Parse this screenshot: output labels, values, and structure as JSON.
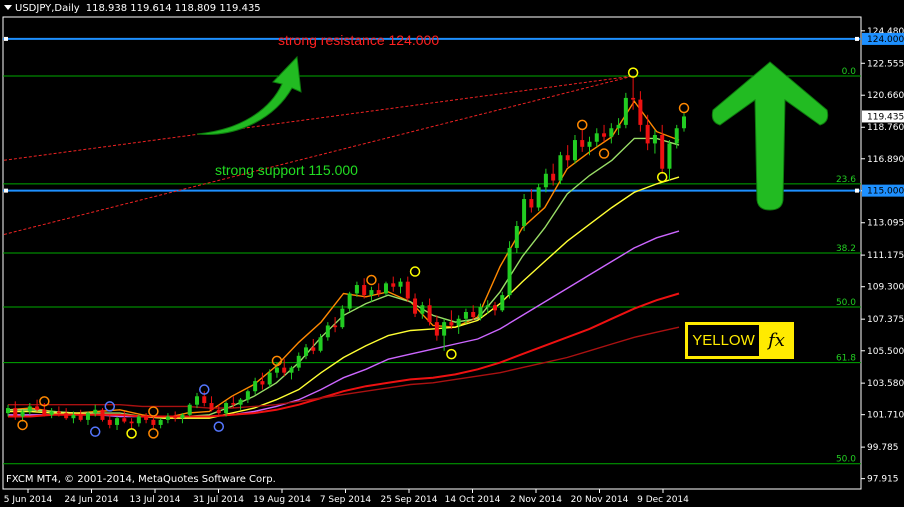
{
  "header": {
    "symbol": "USDJPY,Daily",
    "ohlc": "118.938 119.614 118.809 119.435"
  },
  "footer": {
    "copyright": "FXCM MT4, © 2001-2014, MetaQuotes Software Corp."
  },
  "annotations": {
    "resistance_text": "strong resistance 124.000",
    "support_text": "strong support 115.000",
    "logo_word": "YELLOW",
    "logo_mark": "fx"
  },
  "colors": {
    "background": "#000000",
    "grid_line": "#00aa00",
    "key_line": "#1e90ff",
    "bull": "#22cc22",
    "bear": "#ee1111",
    "ma_fast": "#ff8800",
    "ma_green": "#99dd66",
    "ma_yellow": "#ffff33",
    "ma_purple": "#cc66ff",
    "ma_red": "#ee1111",
    "ma_darkred": "#aa1111",
    "arrow_green": "#22bb22",
    "logo_yellow": "#ffeb00"
  },
  "chart_data": {
    "type": "candlestick",
    "price_axis": {
      "ticks": [
        "124.480",
        "122.555",
        "120.660",
        "118.760",
        "116.890",
        "114.990",
        "113.095",
        "111.175",
        "109.300",
        "107.375",
        "105.500",
        "103.580",
        "101.710",
        "99.785",
        "97.915"
      ],
      "ylim": [
        97.3,
        125.3
      ],
      "current_price_label": "119.435"
    },
    "date_axis": {
      "labels": [
        "5 Jun 2014",
        "24 Jun 2014",
        "13 Jul 2014",
        "31 Jul 2014",
        "19 Aug 2014",
        "7 Sep 2014",
        "25 Sep 2014",
        "14 Oct 2014",
        "2 Nov 2014",
        "20 Nov 2014",
        "9 Dec 2014"
      ]
    },
    "key_levels": [
      {
        "price": 124.0,
        "label": "124.000"
      },
      {
        "price": 115.0,
        "label": "115.000"
      }
    ],
    "fibonacci": [
      {
        "level": "0.0",
        "price": 121.8
      },
      {
        "level": "23.6",
        "price": 115.4
      },
      {
        "level": "38.2",
        "price": 111.3
      },
      {
        "level": "50.0",
        "price": 108.1
      },
      {
        "level": "61.8",
        "price": 104.8
      },
      {
        "level": "50.0",
        "price": 98.8
      }
    ],
    "moving_averages": [
      {
        "color_key": "ma_fast",
        "values": [
          102.0,
          102.1,
          101.9,
          101.8,
          101.9,
          102.0,
          101.7,
          101.5,
          101.8,
          101.9,
          102.8,
          103.5,
          104.6,
          106.0,
          107.2,
          108.9,
          108.7,
          109.0,
          108.4,
          107.0,
          106.9,
          107.5,
          110.5,
          112.8,
          114.0,
          116.3,
          117.3,
          118.2,
          120.3,
          118.5,
          118.0
        ]
      },
      {
        "color_key": "ma_green",
        "values": [
          102.0,
          102.0,
          101.9,
          101.8,
          101.8,
          101.8,
          101.6,
          101.5,
          101.6,
          101.7,
          102.2,
          102.8,
          103.6,
          104.8,
          106.3,
          107.6,
          108.3,
          108.8,
          108.4,
          107.6,
          107.2,
          107.4,
          109.0,
          111.1,
          112.8,
          114.8,
          115.9,
          116.8,
          118.1,
          118.1,
          117.7
        ]
      },
      {
        "color_key": "ma_yellow",
        "values": [
          101.9,
          101.9,
          101.8,
          101.8,
          101.7,
          101.7,
          101.6,
          101.5,
          101.5,
          101.5,
          101.8,
          102.1,
          102.6,
          103.2,
          104.2,
          105.1,
          105.8,
          106.4,
          106.7,
          106.8,
          106.9,
          107.3,
          108.3,
          109.6,
          110.8,
          112.0,
          113.0,
          114.0,
          114.9,
          115.4,
          115.8
        ]
      },
      {
        "color_key": "ma_purple",
        "values": [
          101.7,
          101.7,
          101.7,
          101.7,
          101.7,
          101.6,
          101.6,
          101.6,
          101.6,
          101.6,
          101.7,
          101.9,
          102.2,
          102.6,
          103.2,
          103.9,
          104.4,
          105.0,
          105.3,
          105.6,
          105.9,
          106.2,
          106.8,
          107.6,
          108.4,
          109.2,
          110.0,
          110.8,
          111.6,
          112.2,
          112.6
        ]
      },
      {
        "color_key": "ma_red",
        "values": [
          101.6,
          101.6,
          101.7,
          101.7,
          101.7,
          101.7,
          101.6,
          101.6,
          101.6,
          101.6,
          101.7,
          101.8,
          102.0,
          102.3,
          102.7,
          103.1,
          103.4,
          103.6,
          103.8,
          103.9,
          104.1,
          104.4,
          104.8,
          105.3,
          105.8,
          106.3,
          106.8,
          107.4,
          108.0,
          108.5,
          108.9
        ]
      },
      {
        "color_key": "ma_darkred",
        "values": [
          102.3,
          102.3,
          102.3,
          102.3,
          102.3,
          102.3,
          102.2,
          102.2,
          102.2,
          102.1,
          102.1,
          102.2,
          102.3,
          102.5,
          102.7,
          102.9,
          103.1,
          103.3,
          103.5,
          103.6,
          103.8,
          104.0,
          104.2,
          104.5,
          104.8,
          105.1,
          105.5,
          105.9,
          106.3,
          106.6,
          106.9
        ]
      }
    ],
    "candles": [
      [
        101.8,
        102.3,
        101.6,
        102.1
      ],
      [
        102.1,
        102.5,
        101.4,
        101.6
      ],
      [
        101.6,
        102.0,
        101.3,
        101.9
      ],
      [
        101.9,
        102.4,
        101.7,
        102.2
      ],
      [
        102.2,
        102.6,
        101.9,
        102.0
      ],
      [
        102.0,
        102.4,
        101.6,
        101.7
      ],
      [
        101.7,
        102.1,
        101.5,
        101.9
      ],
      [
        101.9,
        102.2,
        101.6,
        101.8
      ],
      [
        101.8,
        102.1,
        101.4,
        101.5
      ],
      [
        101.5,
        101.9,
        101.2,
        101.7
      ],
      [
        101.7,
        102.0,
        101.3,
        101.4
      ],
      [
        101.4,
        101.9,
        101.1,
        101.8
      ],
      [
        101.8,
        102.3,
        101.6,
        102.0
      ],
      [
        102.0,
        102.1,
        101.3,
        101.4
      ],
      [
        101.4,
        101.7,
        100.9,
        101.1
      ],
      [
        101.1,
        101.6,
        100.8,
        101.5
      ],
      [
        101.5,
        101.9,
        101.2,
        101.3
      ],
      [
        101.3,
        101.5,
        100.9,
        101.2
      ],
      [
        101.2,
        101.7,
        101.0,
        101.6
      ],
      [
        101.6,
        101.8,
        101.2,
        101.4
      ],
      [
        101.4,
        101.6,
        100.9,
        101.1
      ],
      [
        101.1,
        101.5,
        100.9,
        101.4
      ],
      [
        101.4,
        101.8,
        101.2,
        101.6
      ],
      [
        101.6,
        101.9,
        101.3,
        101.5
      ],
      [
        101.5,
        101.8,
        101.2,
        101.7
      ],
      [
        101.7,
        102.4,
        101.6,
        102.3
      ],
      [
        102.3,
        103.0,
        102.1,
        102.8
      ],
      [
        102.8,
        103.1,
        102.2,
        102.4
      ],
      [
        102.4,
        102.8,
        101.9,
        102.0
      ],
      [
        102.0,
        102.3,
        101.6,
        101.8
      ],
      [
        101.8,
        102.5,
        101.6,
        102.4
      ],
      [
        102.4,
        102.8,
        102.1,
        102.3
      ],
      [
        102.3,
        102.7,
        102.0,
        102.6
      ],
      [
        102.6,
        103.2,
        102.4,
        103.1
      ],
      [
        103.1,
        103.9,
        102.9,
        103.7
      ],
      [
        103.7,
        104.2,
        103.2,
        103.5
      ],
      [
        103.5,
        104.4,
        103.3,
        104.2
      ],
      [
        104.2,
        104.8,
        103.9,
        104.5
      ],
      [
        104.5,
        105.0,
        104.0,
        104.2
      ],
      [
        104.2,
        104.6,
        103.8,
        104.5
      ],
      [
        104.5,
        105.4,
        104.3,
        105.2
      ],
      [
        105.2,
        105.9,
        105.0,
        105.7
      ],
      [
        105.7,
        106.2,
        105.3,
        105.5
      ],
      [
        105.5,
        106.5,
        105.4,
        106.3
      ],
      [
        106.3,
        107.2,
        106.1,
        107.0
      ],
      [
        107.0,
        107.5,
        106.6,
        106.9
      ],
      [
        106.9,
        108.2,
        106.8,
        108.0
      ],
      [
        108.0,
        109.0,
        107.8,
        108.9
      ],
      [
        108.9,
        109.6,
        108.7,
        109.4
      ],
      [
        109.4,
        109.8,
        108.6,
        108.8
      ],
      [
        108.8,
        109.3,
        108.4,
        109.1
      ],
      [
        109.1,
        109.5,
        108.7,
        108.9
      ],
      [
        108.9,
        109.6,
        108.8,
        109.5
      ],
      [
        109.5,
        109.9,
        109.0,
        109.3
      ],
      [
        109.3,
        109.8,
        108.9,
        109.6
      ],
      [
        109.6,
        109.9,
        108.4,
        108.6
      ],
      [
        108.6,
        108.9,
        107.5,
        107.7
      ],
      [
        107.7,
        108.4,
        107.4,
        108.2
      ],
      [
        108.2,
        108.6,
        107.0,
        107.2
      ],
      [
        107.2,
        107.6,
        106.1,
        106.4
      ],
      [
        106.4,
        107.4,
        105.5,
        107.2
      ],
      [
        107.2,
        107.9,
        106.8,
        107.0
      ],
      [
        107.0,
        107.6,
        106.5,
        107.4
      ],
      [
        107.4,
        108.0,
        107.1,
        107.8
      ],
      [
        107.8,
        108.2,
        107.3,
        107.5
      ],
      [
        107.5,
        108.3,
        107.3,
        108.1
      ],
      [
        108.1,
        108.5,
        107.7,
        108.2
      ],
      [
        108.2,
        108.4,
        107.6,
        107.9
      ],
      [
        107.9,
        109.0,
        107.8,
        108.8
      ],
      [
        108.8,
        112.0,
        108.6,
        111.6
      ],
      [
        111.6,
        113.2,
        111.3,
        112.9
      ],
      [
        112.9,
        114.8,
        112.6,
        114.5
      ],
      [
        114.5,
        115.1,
        113.7,
        114.0
      ],
      [
        114.0,
        115.4,
        113.8,
        115.2
      ],
      [
        115.2,
        116.3,
        114.9,
        116.0
      ],
      [
        116.0,
        116.6,
        115.3,
        115.6
      ],
      [
        115.6,
        117.3,
        115.4,
        117.1
      ],
      [
        117.1,
        117.7,
        116.4,
        116.8
      ],
      [
        116.8,
        118.3,
        116.6,
        118.0
      ],
      [
        118.0,
        118.6,
        117.3,
        117.6
      ],
      [
        117.6,
        118.2,
        117.1,
        117.9
      ],
      [
        117.9,
        118.7,
        117.6,
        118.4
      ],
      [
        118.4,
        118.9,
        117.9,
        118.2
      ],
      [
        118.2,
        119.0,
        117.8,
        118.7
      ],
      [
        118.7,
        119.3,
        118.3,
        118.9
      ],
      [
        118.9,
        120.8,
        118.7,
        120.5
      ],
      [
        120.5,
        121.8,
        119.8,
        120.4
      ],
      [
        120.4,
        120.9,
        118.5,
        118.9
      ],
      [
        118.9,
        119.5,
        117.4,
        117.8
      ],
      [
        117.8,
        118.6,
        117.2,
        118.3
      ],
      [
        118.3,
        118.9,
        116.0,
        116.3
      ],
      [
        116.3,
        118.0,
        115.6,
        117.8
      ],
      [
        117.8,
        118.9,
        117.5,
        118.7
      ],
      [
        118.7,
        119.6,
        118.5,
        119.4
      ]
    ],
    "swing_markers": [
      {
        "i": 2,
        "price": 101.1,
        "color": "#ff8800"
      },
      {
        "i": 5,
        "price": 102.5,
        "color": "#ff8800"
      },
      {
        "i": 12,
        "price": 100.7,
        "color": "#5577ff"
      },
      {
        "i": 14,
        "price": 102.2,
        "color": "#5577ff"
      },
      {
        "i": 17,
        "price": 100.6,
        "color": "#ffff00"
      },
      {
        "i": 20,
        "price": 100.6,
        "color": "#ff8800"
      },
      {
        "i": 20,
        "price": 101.9,
        "color": "#ff8800"
      },
      {
        "i": 27,
        "price": 103.2,
        "color": "#5577ff"
      },
      {
        "i": 29,
        "price": 101.0,
        "color": "#5577ff"
      },
      {
        "i": 37,
        "price": 104.9,
        "color": "#ff8800"
      },
      {
        "i": 50,
        "price": 109.7,
        "color": "#ff8800"
      },
      {
        "i": 56,
        "price": 110.2,
        "color": "#ffff00"
      },
      {
        "i": 61,
        "price": 105.3,
        "color": "#ffff00"
      },
      {
        "i": 79,
        "price": 118.9,
        "color": "#ff8800"
      },
      {
        "i": 82,
        "price": 117.2,
        "color": "#ff8800"
      },
      {
        "i": 86,
        "price": 122.0,
        "color": "#ffff00"
      },
      {
        "i": 90,
        "price": 115.8,
        "color": "#ffff00"
      },
      {
        "i": 93,
        "price": 119.9,
        "color": "#ff8800"
      }
    ]
  }
}
